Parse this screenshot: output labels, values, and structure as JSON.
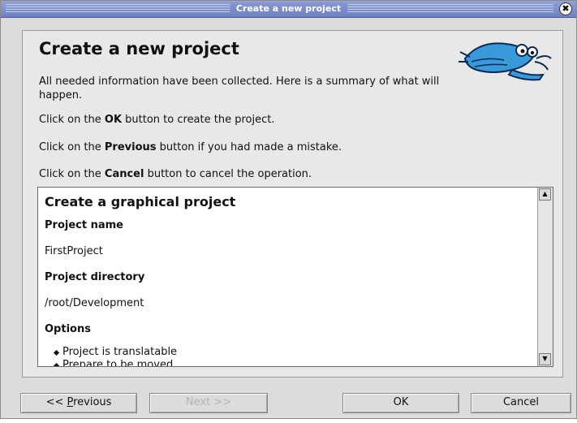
{
  "window": {
    "title": "Create a new project",
    "close_glyph": "✖"
  },
  "page": {
    "heading": "Create a new project",
    "mascot_icon": "mascot-shrimp-icon",
    "summary_intro": "All needed information have been collected. Here is a summary of what will happen.",
    "ok_line": {
      "before": "Click on the ",
      "bold": "OK",
      "after": " button to create the project."
    },
    "previous_line": {
      "before": "Click on the ",
      "bold": "Previous",
      "after": " button if you had made a mistake."
    },
    "cancel_line": {
      "before": "Click on the ",
      "bold": "Cancel",
      "after": " button to cancel the operation."
    }
  },
  "summary": {
    "title": "Create a graphical project",
    "project_name_label": "Project name",
    "project_name": "FirstProject",
    "project_directory_label": "Project directory",
    "project_directory": "/root/Development",
    "options_label": "Options",
    "options": [
      "Project is translatable",
      "Prepare to be moved ..."
    ]
  },
  "buttons": {
    "previous": {
      "prefix": "<< ",
      "mnemonic": "P",
      "rest": "revious"
    },
    "next": "Next >>",
    "ok": "OK",
    "cancel": "Cancel"
  }
}
